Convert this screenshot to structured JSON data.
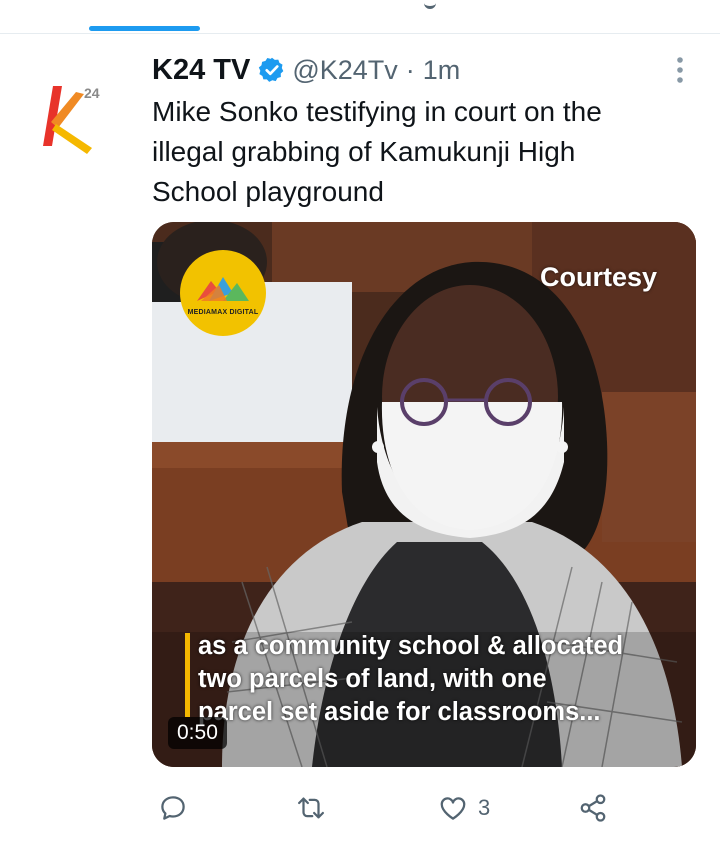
{
  "tweet": {
    "display_name": "K24 TV",
    "handle": "@K24Tv",
    "separator": "·",
    "time": "1m",
    "text": "Mike Sonko testifying in court on the\nillegal grabbing of Kamukunji High\nSchool playground",
    "avatar_icon": "k24-logo-icon",
    "verified_icon": "verified-badge-icon",
    "media": {
      "watermark_text": "MEDIAMAX DIGITAL",
      "overlay_label": "Courtesy",
      "caption": "as a community school & allocated\ntwo parcels of land, with one\nparcel set aside for classrooms...",
      "duration": "0:50"
    },
    "actions": {
      "reply_icon": "reply-icon",
      "retweet_icon": "retweet-icon",
      "like_icon": "heart-icon",
      "like_count": "3",
      "share_icon": "share-icon"
    }
  },
  "colors": {
    "accent": "#1d9bf0",
    "text": "#0f1419",
    "secondary_text": "#536471",
    "caption_bar": "#f5b700",
    "k24_red": "#e8332a",
    "k24_yellow": "#f5b800"
  }
}
